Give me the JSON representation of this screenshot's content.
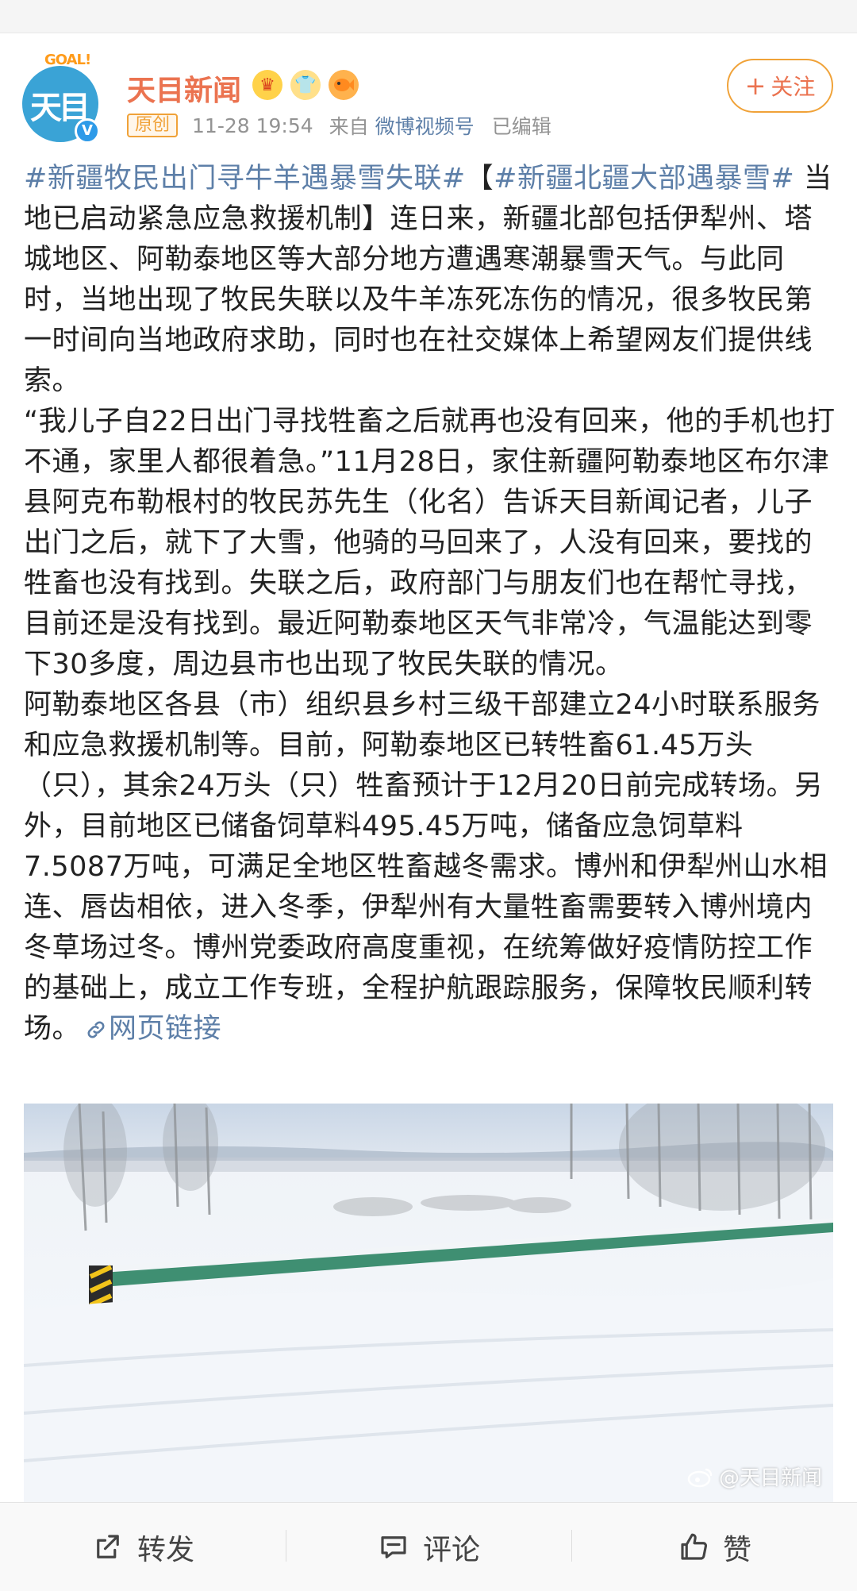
{
  "post": {
    "author": {
      "name": "天目新闻",
      "avatar_text": "天目",
      "avatar_logo_text": "GOAL!",
      "verified_mark": "V",
      "badge_icons": [
        "crown-icon",
        "shirt-icon",
        "fish-icon"
      ]
    },
    "follow_label": "关注",
    "follow_plus": "+",
    "tag": "原创",
    "time": "11-28 19:54",
    "from_label": "来自",
    "source": "微博视频号",
    "edited": "已编辑",
    "content": {
      "hashtag1": "#新疆牧民出门寻牛羊遇暴雪失联#",
      "bracket_open": "【",
      "hashtag2": "#新疆北疆大部遇暴雪#",
      "para1_rest": " 当地已启动紧急应急救援机制】连日来，新疆北部包括伊犁州、塔城地区、阿勒泰地区等大部分地方遭遇寒潮暴雪天气。与此同时，当地出现了牧民失联以及牛羊冻死冻伤的情况，很多牧民第一时间向当地政府求助，同时也在社交媒体上希望网友们提供线索。",
      "para2": "“我儿子自22日出门寻找牲畜之后就再也没有回来，他的手机也打不通，家里人都很着急。”11月28日，家住新疆阿勒泰地区布尔津县阿克布勒根村的牧民苏先生（化名）告诉天目新闻记者，儿子出门之后，就下了大雪，他骑的马回来了，人没有回来，要找的牲畜也没有找到。失联之后，政府部门与朋友们也在帮忙寻找，目前还是没有找到。最近阿勒泰地区天气非常冷，气温能达到零下30多度，周边县市也出现了牧民失联的情况。",
      "para3": "阿勒泰地区各县（市）组织县乡村三级干部建立24小时联系服务和应急救援机制等。目前，阿勒泰地区已转牲畜61.45万头（只），其余24万头（只）牲畜预计于12月20日前完成转场。另外，目前地区已储备饲草料495.45万吨，储备应急饲草料7.5087万吨，可满足全地区牲畜越冬需求。博州和伊犁州山水相连、唇齿相依，进入冬季，伊犁州有大量牲畜需要转入博州境内冬草场过冬。博州党委政府高度重视，在统筹做好疫情防控工作的基础上，成立工作专班，全程护航跟踪服务，保障牧民顺利转场。",
      "link_label": "网页链接"
    },
    "image": {
      "watermark": "@天目新闻"
    }
  },
  "actions": {
    "repost": "转发",
    "comment": "评论",
    "like": "赞"
  },
  "colors": {
    "name": "#eb7350",
    "link": "#5d7fa8",
    "follow_border": "#f0a238",
    "meta_text": "#939393"
  }
}
